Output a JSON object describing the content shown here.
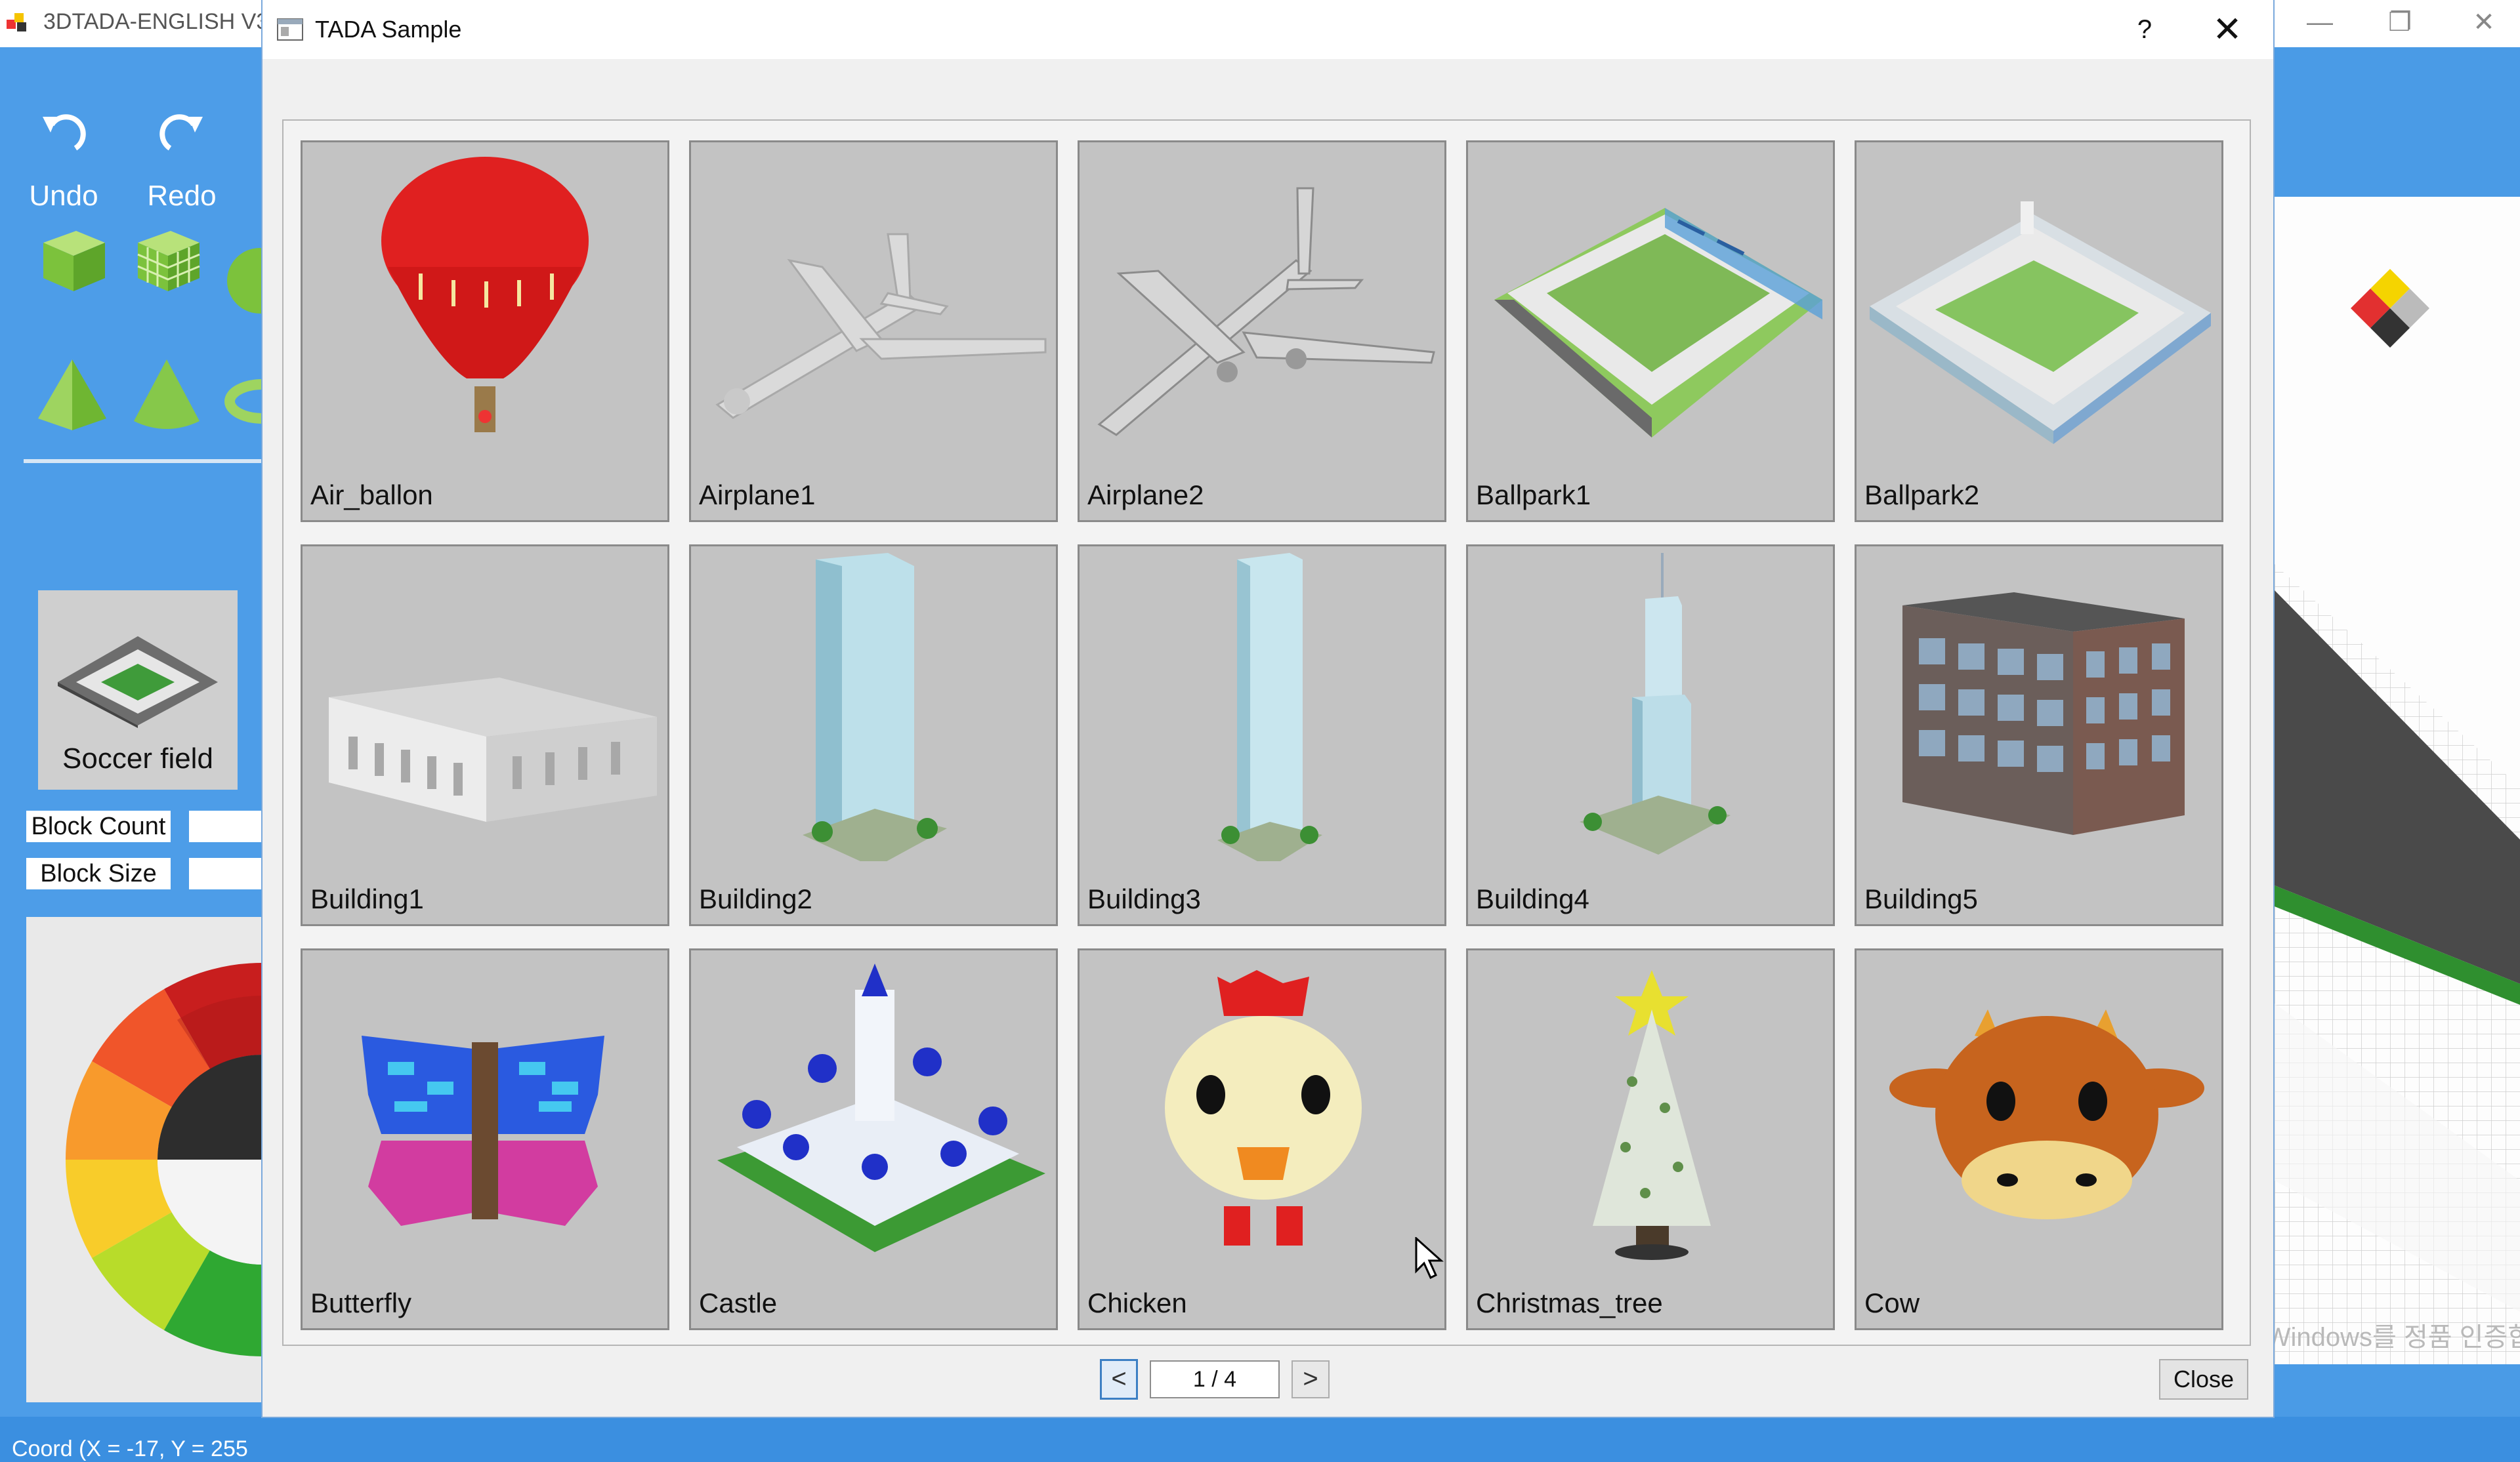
{
  "app": {
    "title": "3DTADA-ENGLISH V3",
    "undo_label": "Undo",
    "redo_label": "Redo",
    "soccer_label": "Soccer field",
    "block_count_label": "Block Count",
    "block_size_label": "Block Size",
    "coord_text": "Coord (X = -17, Y = 255",
    "watermark_text": "Windows 정품 인증... 설정으로 이동하여 Windows를 정품 인증합니다."
  },
  "dialog": {
    "title": "TADA Sample",
    "help_glyph": "?",
    "close_glyph": "✕",
    "samples": [
      {
        "label": "Air_ballon"
      },
      {
        "label": "Airplane1"
      },
      {
        "label": "Airplane2"
      },
      {
        "label": "Ballpark1"
      },
      {
        "label": "Ballpark2"
      },
      {
        "label": "Building1"
      },
      {
        "label": "Building2"
      },
      {
        "label": "Building3"
      },
      {
        "label": "Building4"
      },
      {
        "label": "Building5"
      },
      {
        "label": "Butterfly"
      },
      {
        "label": "Castle"
      },
      {
        "label": "Chicken"
      },
      {
        "label": "Christmas_tree"
      },
      {
        "label": "Cow"
      }
    ],
    "pager": {
      "prev_glyph": "<",
      "page_text": "1 / 4",
      "next_glyph": ">"
    },
    "close_button_label": "Close"
  },
  "colors": {
    "accent": "#3c7fc4",
    "app_background": "#4a9be6",
    "tile_background": "#c3c3c3"
  }
}
